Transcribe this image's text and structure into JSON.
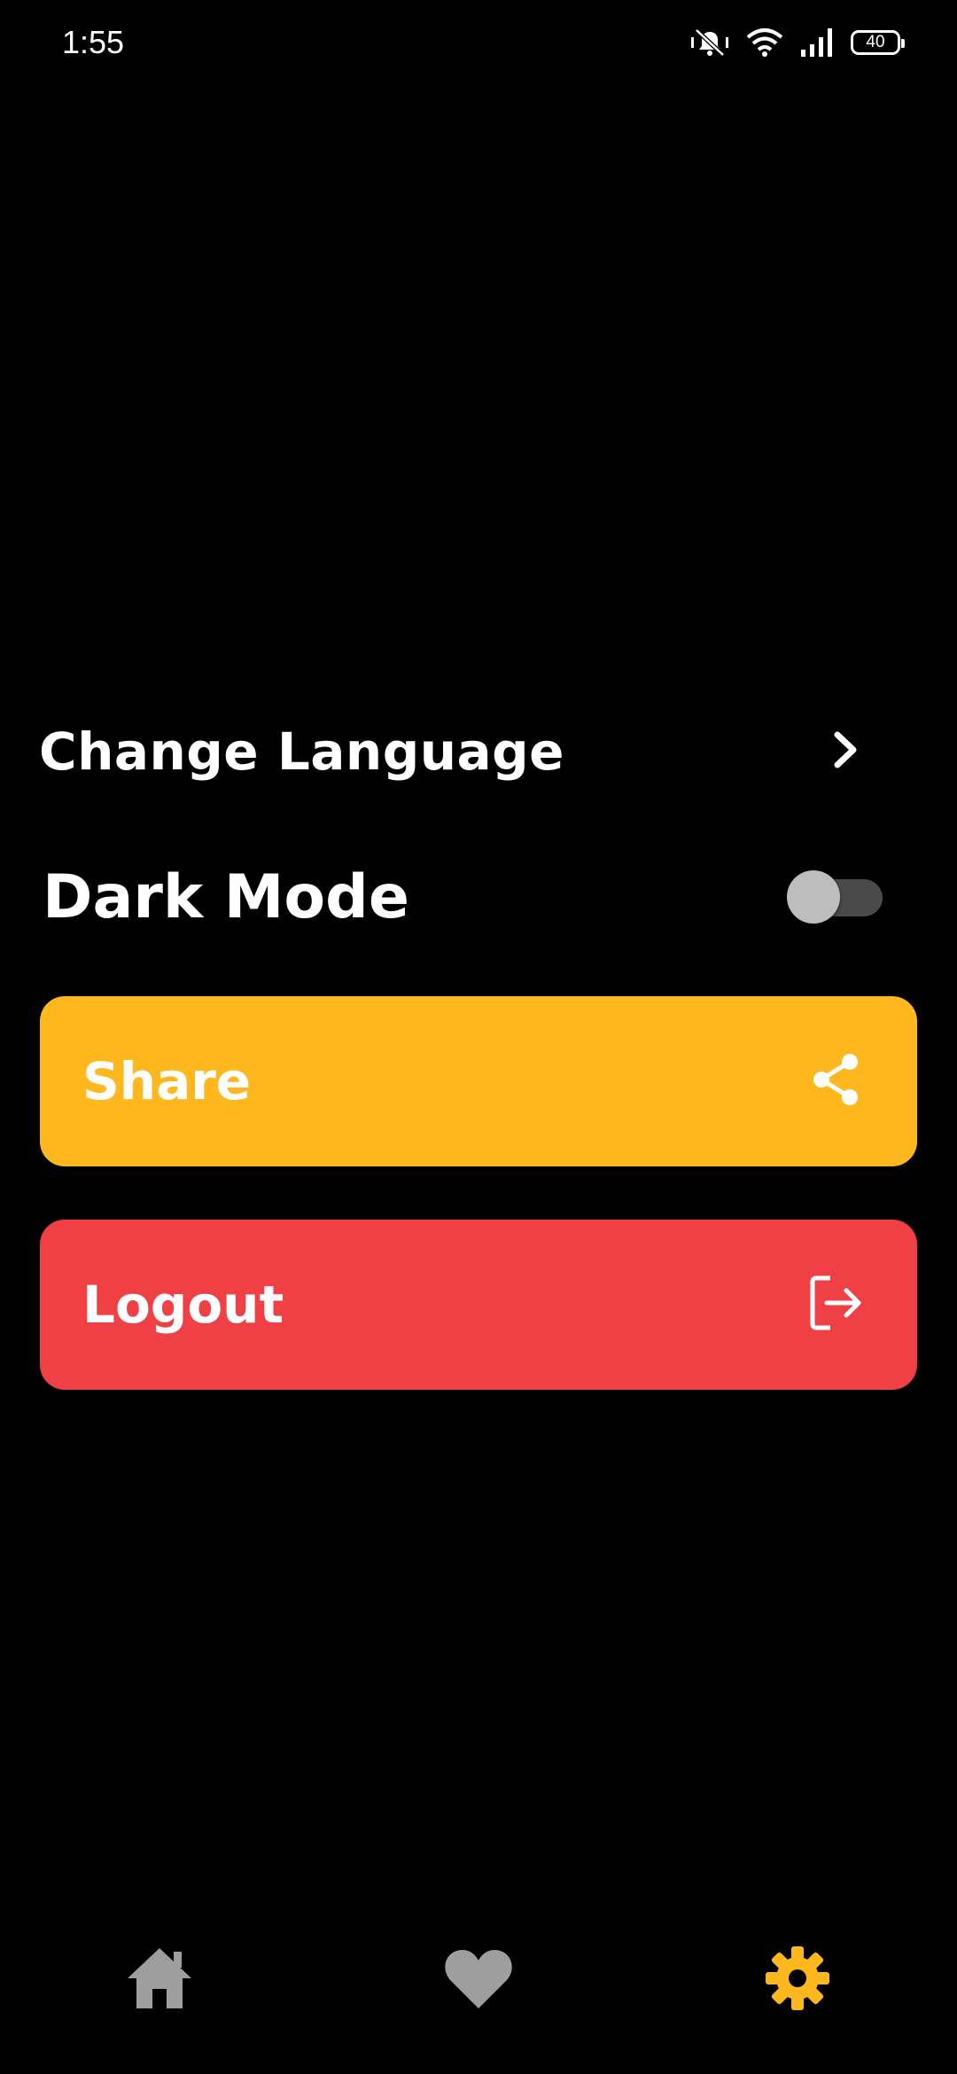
{
  "status_bar": {
    "time": "1:55",
    "battery_level": "40",
    "icons": [
      "vibrate-icon",
      "wifi-icon",
      "signal-icon",
      "battery-icon"
    ]
  },
  "settings": {
    "change_language_label": "Change Language",
    "dark_mode_label": "Dark Mode",
    "dark_mode_enabled": false
  },
  "actions": {
    "share_label": "Share",
    "logout_label": "Logout"
  },
  "bottom_nav": {
    "items": [
      {
        "icon": "home-icon",
        "active": false
      },
      {
        "icon": "heart-icon",
        "active": false
      },
      {
        "icon": "gear-icon",
        "active": true
      }
    ]
  },
  "colors": {
    "background": "#000000",
    "share": "#ffb71e",
    "logout": "#ef4145",
    "nav_inactive": "#9e9e9e",
    "nav_active": "#ffb71e",
    "toggle_track": "#4a4a4a",
    "toggle_thumb": "#bdbdbd"
  }
}
